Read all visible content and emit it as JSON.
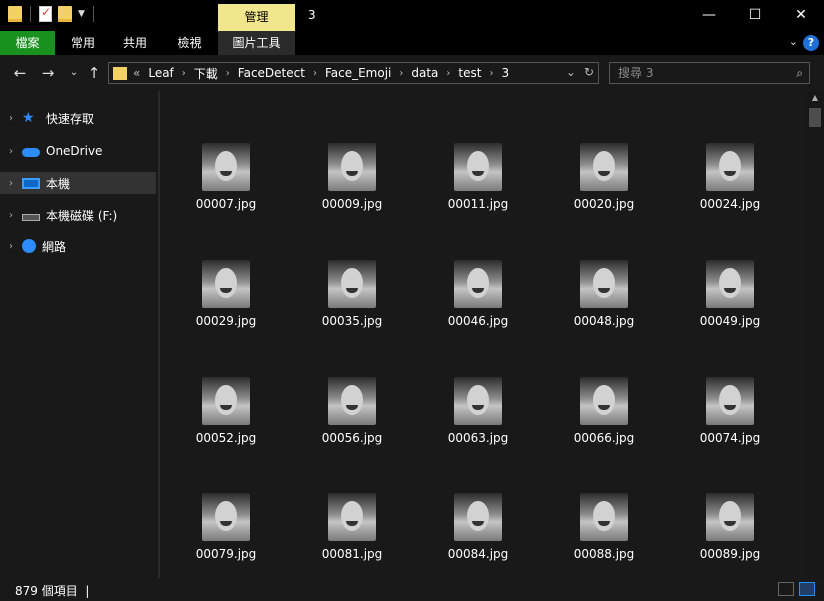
{
  "window": {
    "title": "3"
  },
  "ribbon": {
    "context_title": "管理",
    "tabs": [
      {
        "label": "檔案"
      },
      {
        "label": "常用"
      },
      {
        "label": "共用"
      },
      {
        "label": "檢視"
      },
      {
        "label": "圖片工具"
      }
    ],
    "help_label": "?"
  },
  "nav": {
    "path": [
      "Leaf",
      "下載",
      "FaceDetect",
      "Face_Emoji",
      "data",
      "test",
      "3"
    ],
    "overflow": "«",
    "search_placeholder": "搜尋 3"
  },
  "sidebar": {
    "items": [
      {
        "label": "快速存取",
        "icon": "star-icon"
      },
      {
        "label": "OneDrive",
        "icon": "cloud-icon"
      },
      {
        "label": "本機",
        "icon": "computer-icon",
        "selected": true
      },
      {
        "label": "本機磁碟 (F:)",
        "icon": "drive-icon"
      },
      {
        "label": "網路",
        "icon": "network-icon"
      }
    ]
  },
  "files": [
    "00007.jpg",
    "00009.jpg",
    "00011.jpg",
    "00020.jpg",
    "00024.jpg",
    "00029.jpg",
    "00035.jpg",
    "00046.jpg",
    "00048.jpg",
    "00049.jpg",
    "00052.jpg",
    "00056.jpg",
    "00063.jpg",
    "00066.jpg",
    "00074.jpg",
    "00079.jpg",
    "00081.jpg",
    "00084.jpg",
    "00088.jpg",
    "00089.jpg"
  ],
  "status": {
    "item_count": "879 個項目"
  },
  "colors": {
    "file_tab": "#18911f",
    "context_tab": "#f2e68d",
    "accent": "#2d8cff"
  }
}
